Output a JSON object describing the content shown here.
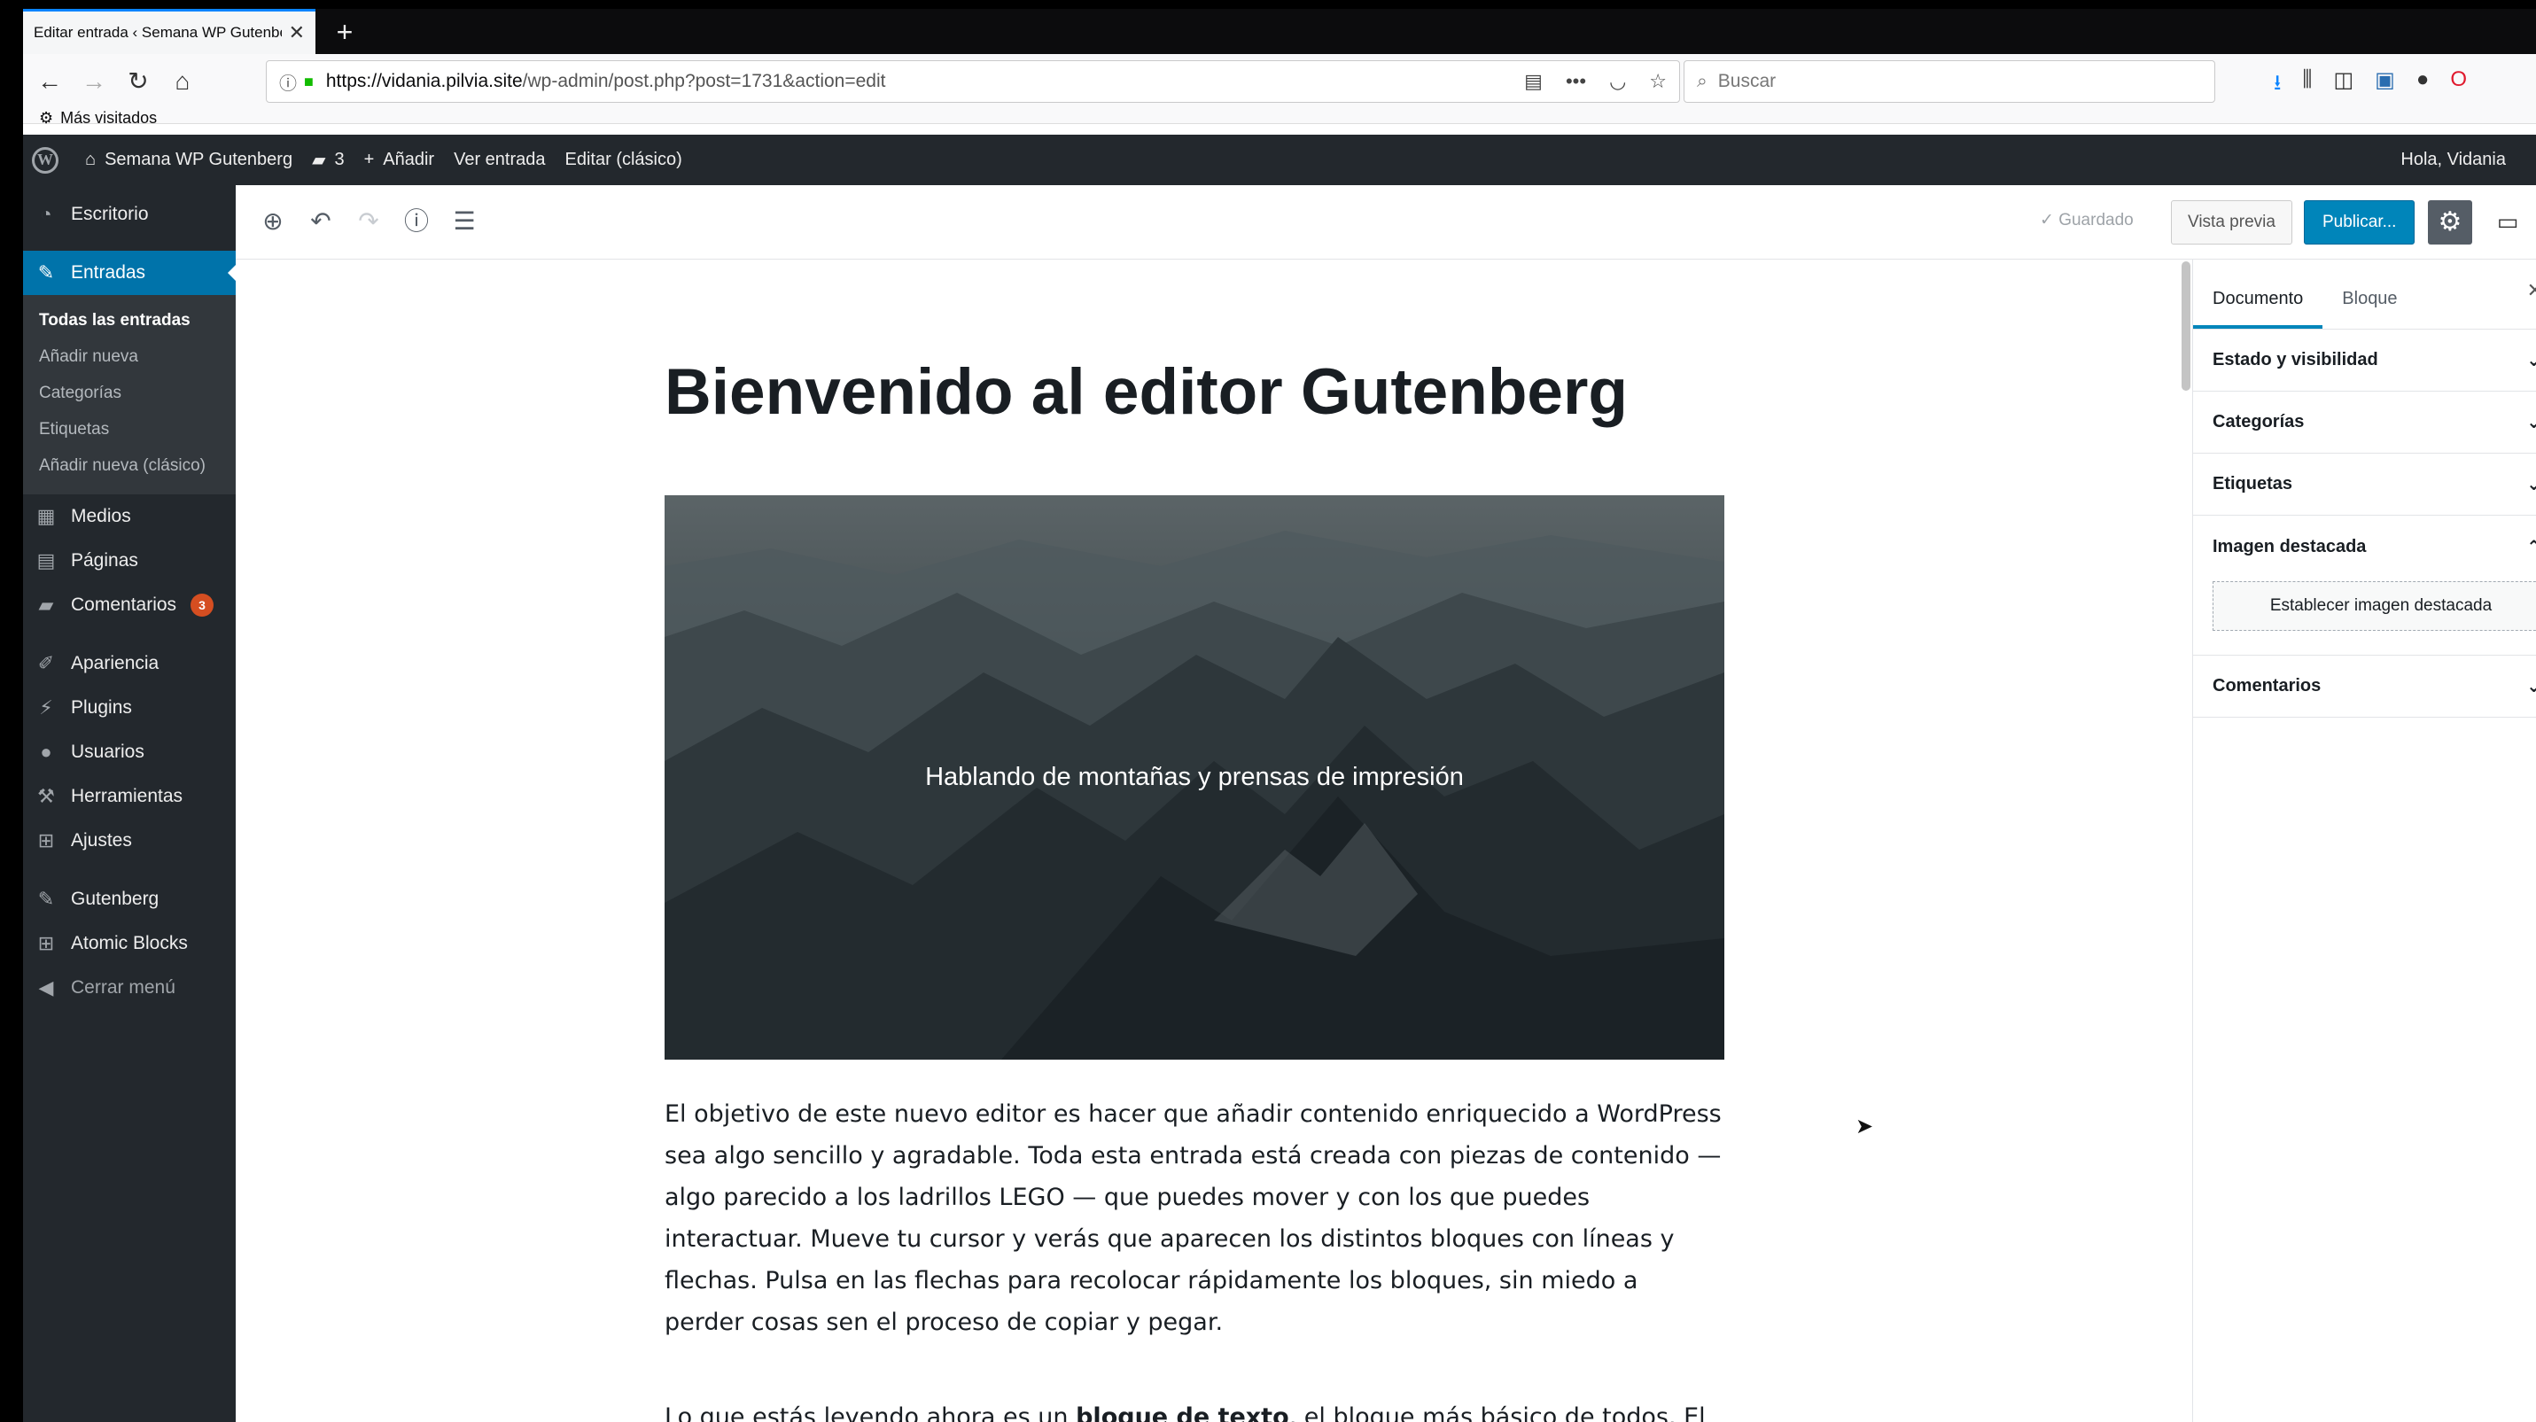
{
  "browser": {
    "tab_title": "Editar entrada ‹ Semana WP Gutenberg",
    "tab_close": "✕",
    "new_tab": "+",
    "url_host": "https://vidania.pilvia.site",
    "url_path": "/wp-admin/post.php?post=1731&action=edit",
    "search_placeholder": "Buscar",
    "bookmark_label": "Más visitados"
  },
  "adminbar": {
    "site_name": "Semana WP Gutenberg",
    "comments_count": "3",
    "add_new": "Añadir",
    "view_post": "Ver entrada",
    "edit_classic": "Editar (clásico)",
    "greeting": "Hola, Vidania"
  },
  "sidebar": {
    "dashboard": "Escritorio",
    "posts": "Entradas",
    "posts_sub": [
      "Todas las entradas",
      "Añadir nueva",
      "Categorías",
      "Etiquetas",
      "Añadir nueva (clásico)"
    ],
    "media": "Medios",
    "pages": "Páginas",
    "comments": "Comentarios",
    "comments_badge": "3",
    "appearance": "Apariencia",
    "plugins": "Plugins",
    "users": "Usuarios",
    "tools": "Herramientas",
    "settings": "Ajustes",
    "gutenberg": "Gutenberg",
    "atomic_blocks": "Atomic Blocks",
    "collapse": "Cerrar menú"
  },
  "editor_header": {
    "saved": "Guardado",
    "preview": "Vista previa",
    "publish": "Publicar..."
  },
  "post": {
    "title": "Bienvenido al editor Gutenberg",
    "cover_caption": "Hablando de montañas y prensas de impresión",
    "paragraph1": "El objetivo de este nuevo editor es hacer que añadir contenido enriquecido a WordPress sea algo sencillo y agradable. Toda esta entrada está creada con piezas de contenido —algo parecido a los ladrillos LEGO — que puedes mover y con los que puedes interactuar. Mueve tu cursor y verás que aparecen los distintos bloques con líneas y flechas. Pulsa en las flechas para recolocar rápidamente los bloques, sin miedo a perder cosas sen el proceso de copiar y pegar.",
    "paragraph2_pre": "Lo que estás leyendo ahora es un ",
    "paragraph2_bold": "bloque de texto",
    "paragraph2_post": ", el bloque más básico de todos. El"
  },
  "settings_sidebar": {
    "tab_document": "Documento",
    "tab_block": "Bloque",
    "panels": {
      "status": "Estado y visibilidad",
      "categories": "Categorías",
      "tags": "Etiquetas",
      "featured": "Imagen destacada",
      "featured_button": "Establecer imagen destacada",
      "comments": "Comentarios"
    }
  },
  "colors": {
    "admin_dark": "#23282d",
    "accent_blue": "#0073aa",
    "publish_blue": "#0085ba",
    "badge_orange": "#d54e21"
  }
}
